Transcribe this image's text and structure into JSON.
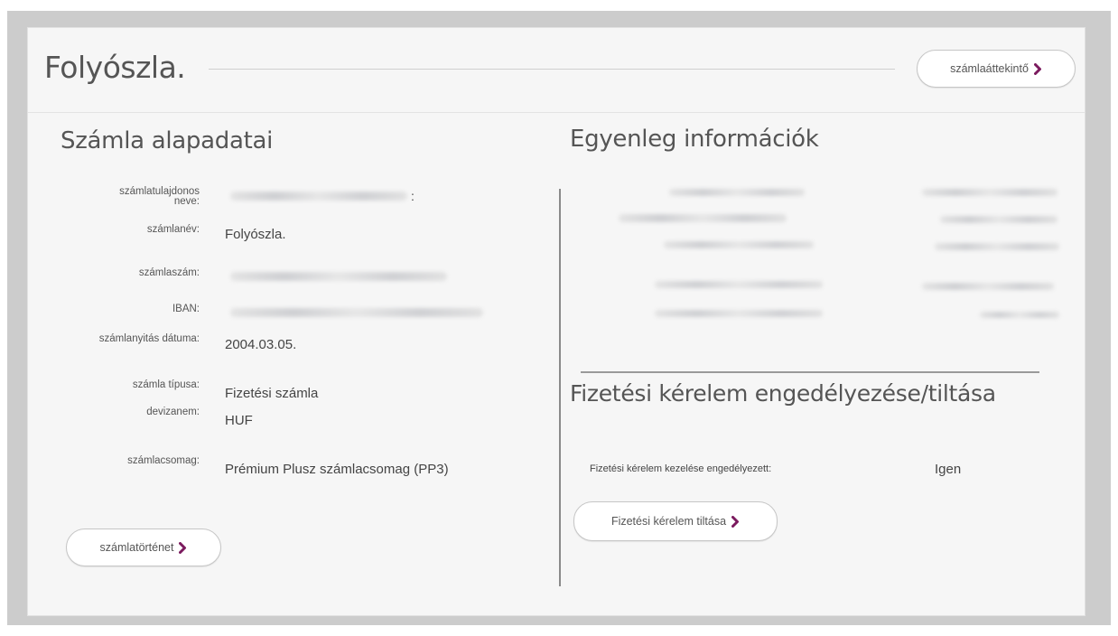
{
  "header": {
    "title": "Folyószla.",
    "overview_button": "számlaáttekintő"
  },
  "basic": {
    "title": "Számla alapadatai",
    "fields": [
      {
        "label": "számlatulajdonos neve:",
        "value": ""
      },
      {
        "label": "számlanév:",
        "value": "Folyószla."
      },
      {
        "label": "számlaszám:",
        "value": ""
      },
      {
        "label": "IBAN:",
        "value": ""
      },
      {
        "label": "számlanyitás dátuma:",
        "value": "2004.03.05."
      },
      {
        "label": "számla típusa:",
        "value": "Fizetési számla"
      },
      {
        "label": "devizanem:",
        "value": "HUF"
      },
      {
        "label": "számlacsomag:",
        "value": "Prémium Plusz számlacsomag (PP3)"
      }
    ],
    "history_button": "számlatörténet"
  },
  "balance": {
    "title": "Egyenleg információk"
  },
  "payment_request": {
    "title": "Fizetési kérelem engedélyezése/tiltása",
    "label": "Fizetési kérelem kezelése engedélyezett:",
    "value": "Igen",
    "deny_button": "Fizetési kérelem tiltása"
  },
  "colors": {
    "accent": "#7b1a5e",
    "frame": "#cccccc",
    "card": "#f6f6f6"
  },
  "icons": [
    "chevron-right-icon"
  ]
}
